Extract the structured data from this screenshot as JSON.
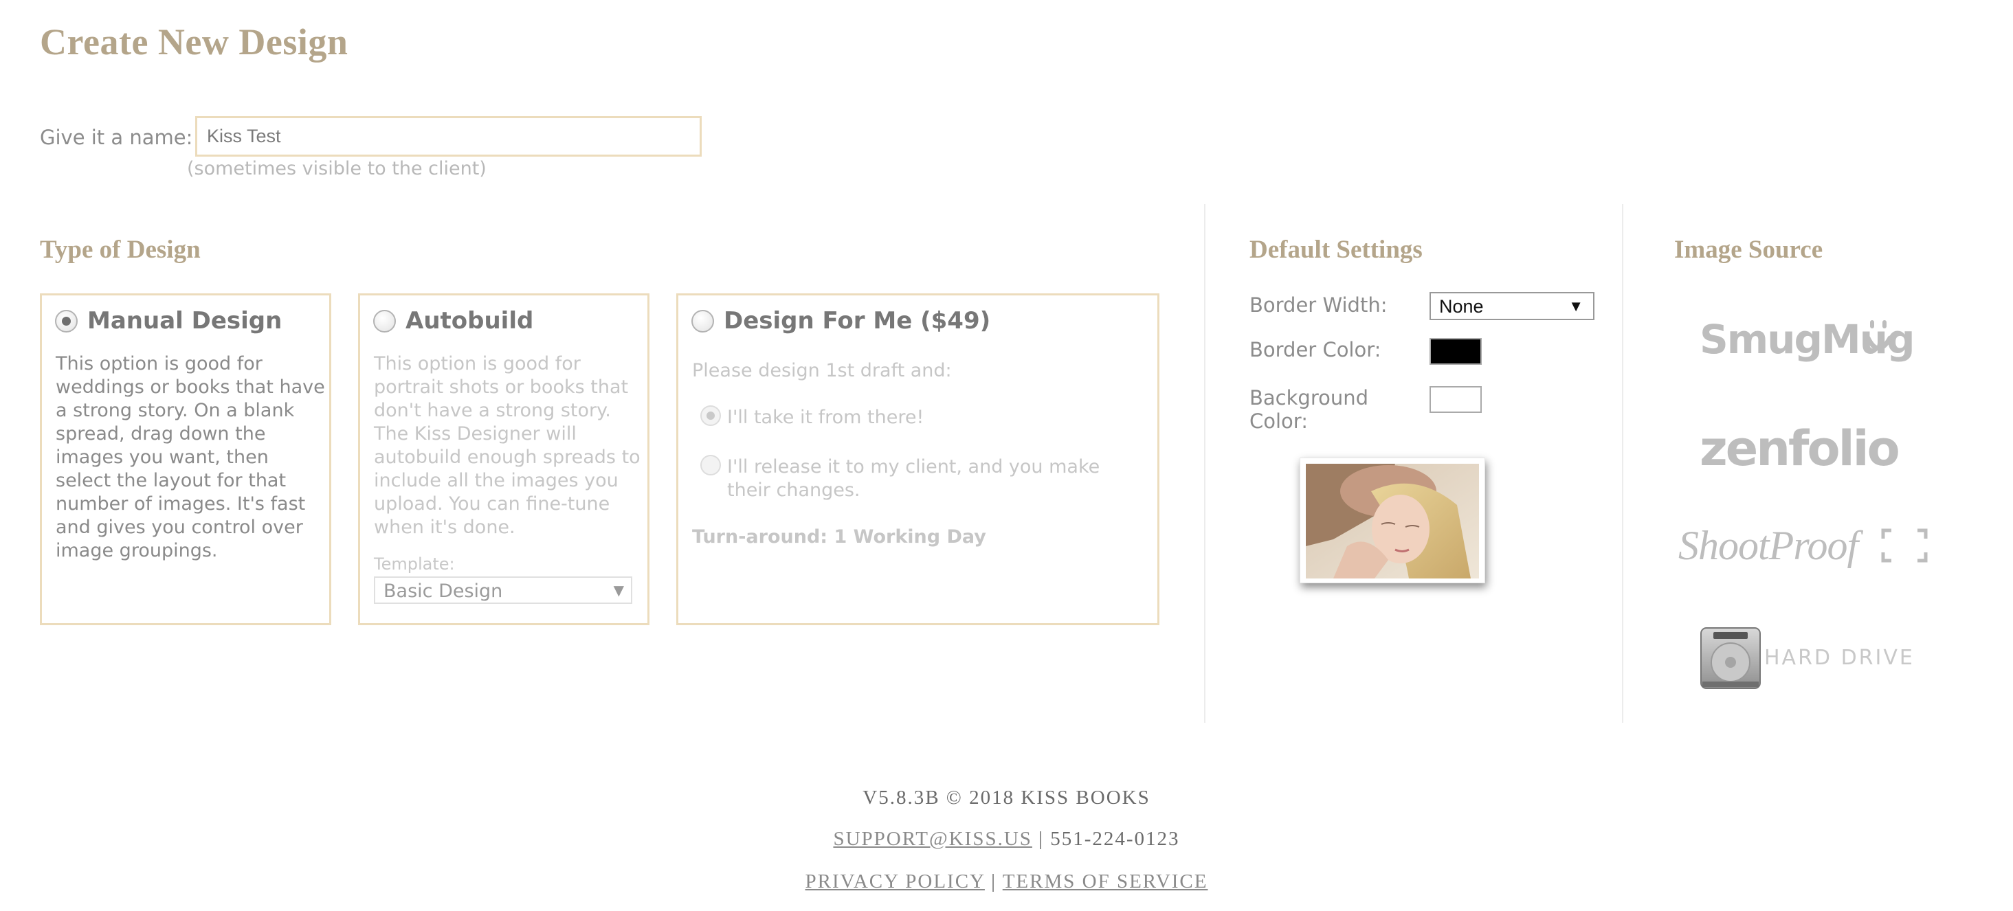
{
  "page": {
    "title": "Create New Design"
  },
  "name_field": {
    "label": "Give it a name:",
    "value": "Kiss Test",
    "hint": "(sometimes visible to the client)"
  },
  "type_of_design": {
    "title": "Type of Design",
    "options": [
      {
        "label": "Manual Design",
        "selected": true,
        "description": "This option is good for weddings or books that have a strong story. On a blank spread, drag down the images you want, then select the layout for that number of images. It's fast and gives you control over image groupings."
      },
      {
        "label": "Autobuild",
        "selected": false,
        "description": "This option is good for portrait shots or books that don't have a strong story. The Kiss Designer will autobuild enough spreads to include all the images you upload. You can fine-tune when it's done.",
        "template_label": "Template:",
        "template_value": "Basic Design"
      },
      {
        "label": "Design For Me ($49)",
        "selected": false,
        "prompt": "Please design 1st draft and:",
        "choices": [
          {
            "label": "I'll take it from there!",
            "selected": true
          },
          {
            "label": "I'll release it to my client, and you make their changes.",
            "selected": false
          }
        ],
        "turnaround": "Turn-around: 1 Working Day"
      }
    ]
  },
  "default_settings": {
    "title": "Default Settings",
    "border_width_label": "Border Width:",
    "border_width_value": "None",
    "border_color_label": "Border Color:",
    "border_color": "#000000",
    "background_color_label": "Background Color:",
    "background_color": "#ffffff"
  },
  "image_source": {
    "title": "Image Source",
    "sources": [
      {
        "name": "SmugMug",
        "icon": "smugmug-logo"
      },
      {
        "name": "zenfolio",
        "icon": "zenfolio-logo"
      },
      {
        "name": "ShootProof",
        "icon": "shootproof-logo"
      },
      {
        "name": "HARD DRIVE",
        "icon": "hard-drive-icon"
      }
    ]
  },
  "footer": {
    "version": "V5.8.3B © 2018 KISS BOOKS",
    "support_email": "SUPPORT@KISS.US",
    "separator": "|",
    "phone": "551-224-0123",
    "privacy": "PRIVACY POLICY",
    "terms": "TERMS OF SERVICE"
  },
  "colors": {
    "accent": "#b4a58a",
    "box_border": "#ecdcbc"
  }
}
